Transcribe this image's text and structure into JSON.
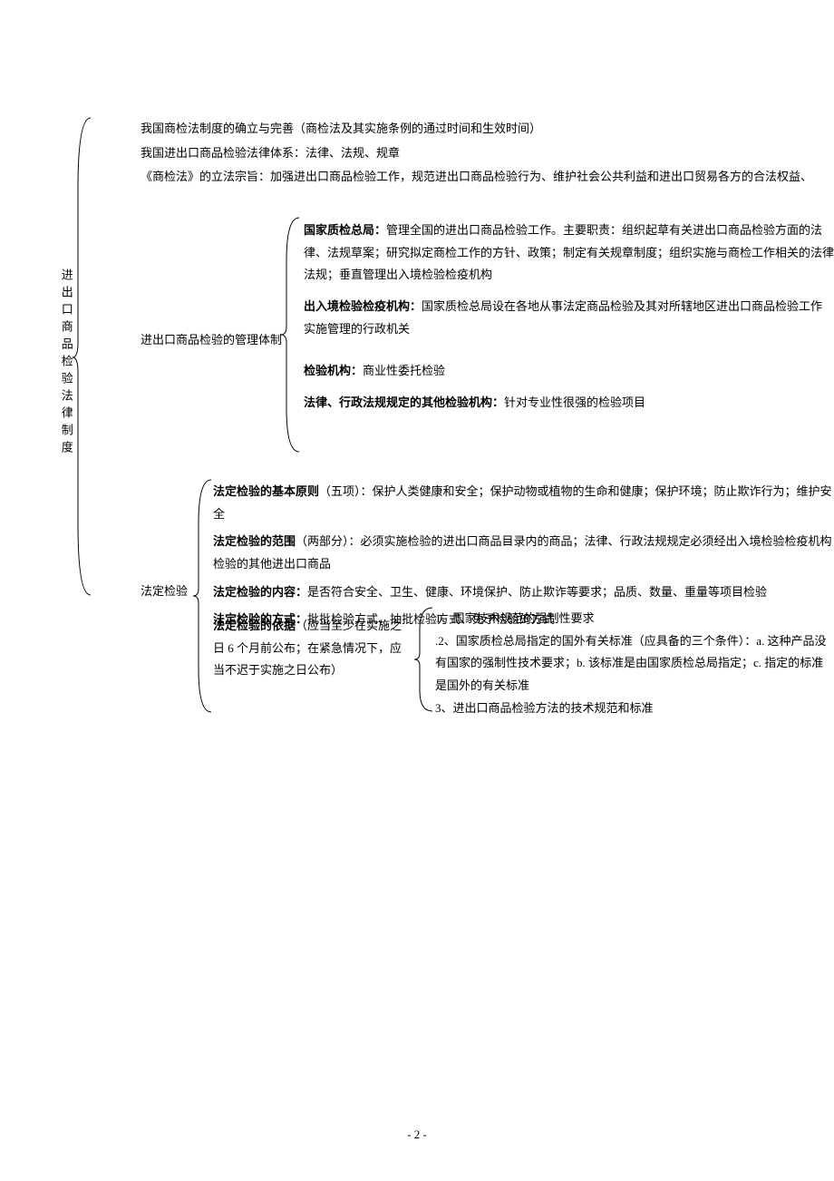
{
  "vertical_title": "进出口商品检验法律制度",
  "top": {
    "line1": "我国商检法制度的确立与完善（商检法及其实施条例的通过时间和生效时间）",
    "line2": "我国进出口商品检验法律体系：法律、法规、规章",
    "line3": "《商检法》的立法宗旨：加强进出口商品检验工作，规范进出口商品检验行为、维护社会公共利益和进出口贸易各方的合法权益、"
  },
  "mgmt": {
    "label": "进出口商品检验的管理体制",
    "item1_bold": "国家质检总局：",
    "item1_text": "管理全国的进出口商品检验工作。主要职责：组织起草有关进出口商品检验方面的法律、法规草案；研究拟定商检工作的方针、政策；制定有关规章制度；组织实施与商检工作相关的法律法规；垂直管理出入境检验检疫机构",
    "item2_bold": "出入境检验检疫机构：",
    "item2_text": "国家质检总局设在各地从事法定商品检验及其对所辖地区进出口商品检验工作实施管理的行政机关",
    "item3_bold": "检验机构：",
    "item3_text": "商业性委托检验",
    "item4_bold": "法律、行政法规规定的其他检验机构：",
    "item4_text": "针对专业性很强的检验项目"
  },
  "statutory": {
    "label": "法定检验",
    "p1_bold": "法定检验的基本原则",
    "p1_text": "（五项）：保护人类健康和安全；保护动物或植物的生命和健康；保护环境；防止欺诈行为；维护安全",
    "p2_bold": "法定检验的范围",
    "p2_text": "（两部分）：必须实施检验的进出口商品目录内的商品；法律、行政法规规定必须经出入境检验检疫机构检验的其他进出口商品",
    "p3_bold": "法定检验的内容：",
    "p3_text": "是否符合安全、卫生、健康、环境保护、防止欺诈等要求；品质、数量、重量等项目检验",
    "p4_bold": "法定检验的方式：",
    "p4_text": "批批检验方式、抽批检验方式、免予检验的方式",
    "basis_bold": "法定检验的依据",
    "basis_text": "（应当至少在实施之日 6 个月前公布；在紧急情况下，应当不迟于实施之日公布）",
    "basis_items": {
      "i1": "1、国家技术规范的强制性要求",
      "i2": ".2、国家质检总局指定的国外有关标准（应具备的三个条件）：a. 这种产品没有国家的强制性技术要求；b. 该标准是由国家质检总局指定；c. 指定的标准是国外的有关标准",
      "i3": "3、进出口商品检验方法的技术规范和标准"
    }
  },
  "page_number": "- 2 -"
}
